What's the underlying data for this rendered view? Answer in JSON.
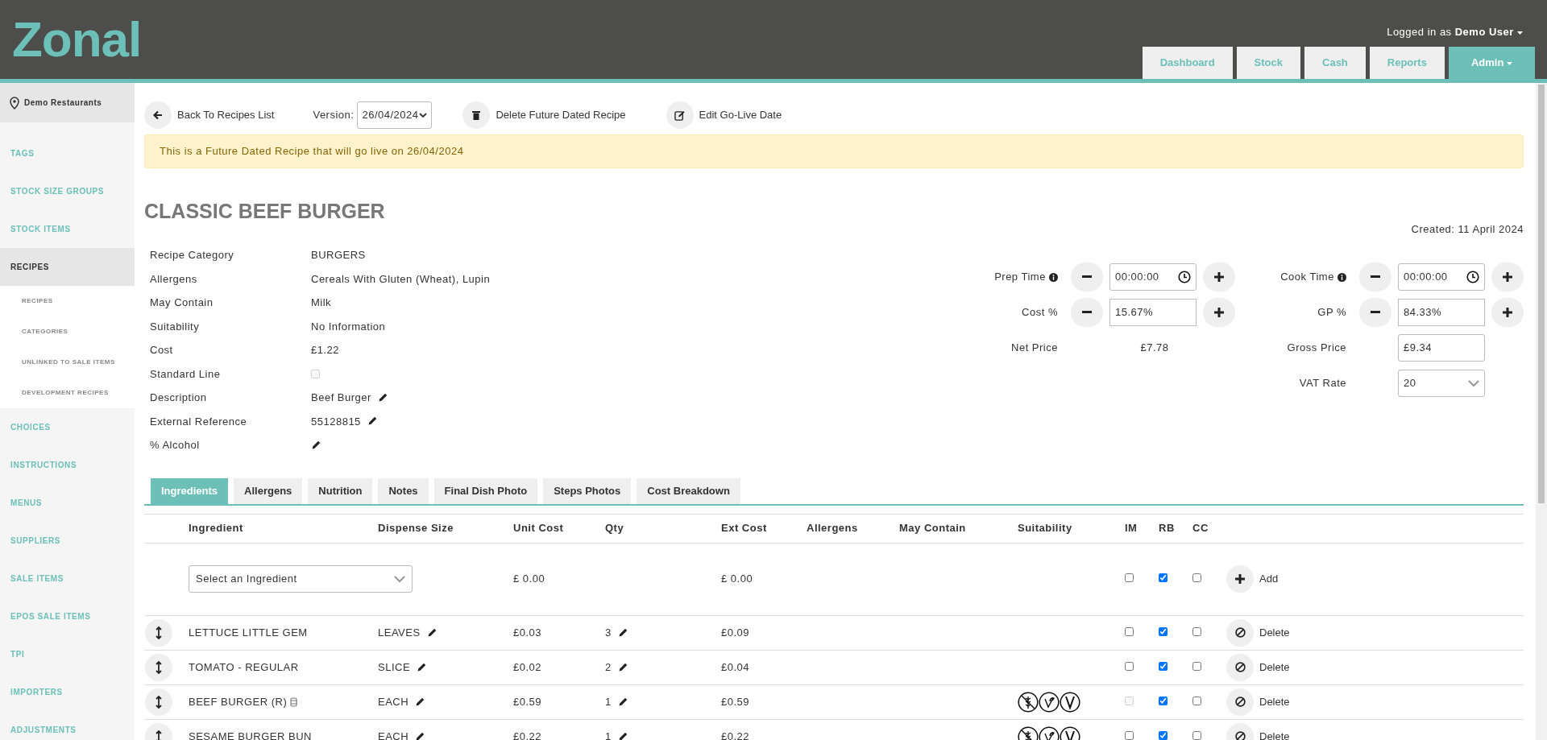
{
  "header": {
    "logo": "Zonal",
    "user_prefix": "Logged in as",
    "user_name": "Demo User",
    "nav": [
      {
        "label": "Dashboard",
        "selected": false,
        "dropdown": false
      },
      {
        "label": "Stock",
        "selected": false,
        "dropdown": false
      },
      {
        "label": "Cash",
        "selected": false,
        "dropdown": false
      },
      {
        "label": "Reports",
        "selected": false,
        "dropdown": false
      },
      {
        "label": "Admin",
        "selected": true,
        "dropdown": true
      }
    ]
  },
  "sidebar": {
    "location": "Demo Restaurants",
    "items": [
      {
        "label": "TAGS",
        "selected": false
      },
      {
        "label": "STOCK SIZE GROUPS",
        "selected": false
      },
      {
        "label": "STOCK ITEMS",
        "selected": false
      },
      {
        "label": "RECIPES",
        "selected": true,
        "expanded": true,
        "children": [
          {
            "label": "RECIPES",
            "selected": false
          },
          {
            "label": "CATEGORIES",
            "selected": false
          },
          {
            "label": "UNLINKED TO SALE ITEMS",
            "selected": false
          },
          {
            "label": "DEVELOPMENT RECIPES",
            "selected": false
          }
        ]
      },
      {
        "label": "CHOICES",
        "selected": false
      },
      {
        "label": "INSTRUCTIONS",
        "selected": false
      },
      {
        "label": "MENUS",
        "selected": false
      },
      {
        "label": "SUPPLIERS",
        "selected": false
      },
      {
        "label": "SALE ITEMS",
        "selected": false
      },
      {
        "label": "EPOS SALE ITEMS",
        "selected": false
      },
      {
        "label": "TPI",
        "selected": false
      },
      {
        "label": "IMPORTERS",
        "selected": false
      },
      {
        "label": "ADJUSTMENTS",
        "selected": false
      }
    ]
  },
  "toolbar": {
    "back": "Back To Recipes List",
    "version_label": "Version:",
    "version": "26/04/2024",
    "delete": "Delete Future Dated Recipe",
    "edit_date": "Edit Go-Live Date"
  },
  "alert": "This is a Future Dated Recipe that will go live on 26/04/2024",
  "recipe": {
    "title": "CLASSIC BEEF BURGER",
    "created": "Created: 11 April 2024",
    "details": [
      {
        "label": "Recipe Category",
        "kind": "text",
        "value": "BURGERS"
      },
      {
        "label": "Allergens",
        "kind": "text",
        "value": "Cereals With Gluten (Wheat), Lupin"
      },
      {
        "label": "May Contain",
        "kind": "text",
        "value": "Milk"
      },
      {
        "label": "Suitability",
        "kind": "text",
        "value": "No Information"
      },
      {
        "label": "Cost",
        "kind": "text",
        "value": "£1.22"
      },
      {
        "label": "Standard Line",
        "kind": "checkbox",
        "checked": false
      },
      {
        "label": "Description",
        "kind": "editable",
        "value": "Beef Burger"
      },
      {
        "label": "External Reference",
        "kind": "editable",
        "value": "55128815"
      },
      {
        "label": "% Alcohol",
        "kind": "editable"
      }
    ]
  },
  "pricing": {
    "prep_time": {
      "label": "Prep Time",
      "value": "00:00:00"
    },
    "cook_time": {
      "label": "Cook Time",
      "value": "00:00:00"
    },
    "cost_pct": {
      "label": "Cost %",
      "value": "15.67%"
    },
    "gp_pct": {
      "label": "GP %",
      "value": "84.33%"
    },
    "net_price": {
      "label": "Net Price",
      "value": "£7.78"
    },
    "gross_price": {
      "label": "Gross Price",
      "value": "£9.34"
    },
    "vat_rate": {
      "label": "VAT Rate",
      "value": "20"
    }
  },
  "tabs": [
    {
      "label": "Ingredients",
      "selected": true
    },
    {
      "label": "Allergens",
      "selected": false
    },
    {
      "label": "Nutrition",
      "selected": false
    },
    {
      "label": "Notes",
      "selected": false
    },
    {
      "label": "Final Dish Photo",
      "selected": false
    },
    {
      "label": "Steps Photos",
      "selected": false
    },
    {
      "label": "Cost Breakdown",
      "selected": false
    }
  ],
  "table": {
    "columns": [
      "Ingredient",
      "Dispense Size",
      "Unit Cost",
      "Qty",
      "Ext Cost",
      "Allergens",
      "May Contain",
      "Suitability",
      "IM",
      "RB",
      "CC"
    ],
    "add_row": {
      "placeholder": "Select an Ingredient",
      "unit_cost": "£ 0.00",
      "ext_cost": "£ 0.00",
      "im": {
        "checked": false,
        "disabled": false
      },
      "rb": {
        "checked": true,
        "disabled": false
      },
      "cc": {
        "checked": false,
        "disabled": false
      },
      "action": "Add"
    },
    "rows": [
      {
        "ingredient": "LETTUCE LITTLE GEM",
        "linked_recipe": false,
        "dispense_size": "LEAVES",
        "unit_cost": "£0.03",
        "qty": "3",
        "ext_cost": "£0.09",
        "suitability": [],
        "im": {
          "checked": false,
          "disabled": false
        },
        "rb": {
          "checked": true,
          "disabled": false
        },
        "cc": {
          "checked": false,
          "disabled": false
        },
        "action": "Delete"
      },
      {
        "ingredient": "TOMATO - REGULAR",
        "linked_recipe": false,
        "dispense_size": "SLICE",
        "unit_cost": "£0.02",
        "qty": "2",
        "ext_cost": "£0.04",
        "suitability": [],
        "im": {
          "checked": false,
          "disabled": false
        },
        "rb": {
          "checked": true,
          "disabled": false
        },
        "cc": {
          "checked": false,
          "disabled": false
        },
        "action": "Delete"
      },
      {
        "ingredient": "BEEF BURGER (R)",
        "linked_recipe": true,
        "dispense_size": "EACH",
        "unit_cost": "£0.59",
        "qty": "1",
        "ext_cost": "£0.59",
        "suitability": [
          {
            "kind": "no-gluten"
          },
          {
            "kind": "vegan"
          },
          {
            "kind": "vegetarian"
          }
        ],
        "im": {
          "checked": false,
          "disabled": true
        },
        "rb": {
          "checked": true,
          "disabled": false
        },
        "cc": {
          "checked": false,
          "disabled": false
        },
        "action": "Delete"
      },
      {
        "ingredient": "SESAME BURGER BUN",
        "linked_recipe": false,
        "dispense_size": "EACH",
        "unit_cost": "£0.22",
        "qty": "1",
        "ext_cost": "£0.22",
        "suitability": [
          {
            "kind": "no-gluten"
          },
          {
            "kind": "vegan"
          },
          {
            "kind": "vegetarian"
          }
        ],
        "im": {
          "checked": false,
          "disabled": false
        },
        "rb": {
          "checked": true,
          "disabled": false
        },
        "cc": {
          "checked": false,
          "disabled": false
        },
        "action": "Delete"
      }
    ]
  }
}
